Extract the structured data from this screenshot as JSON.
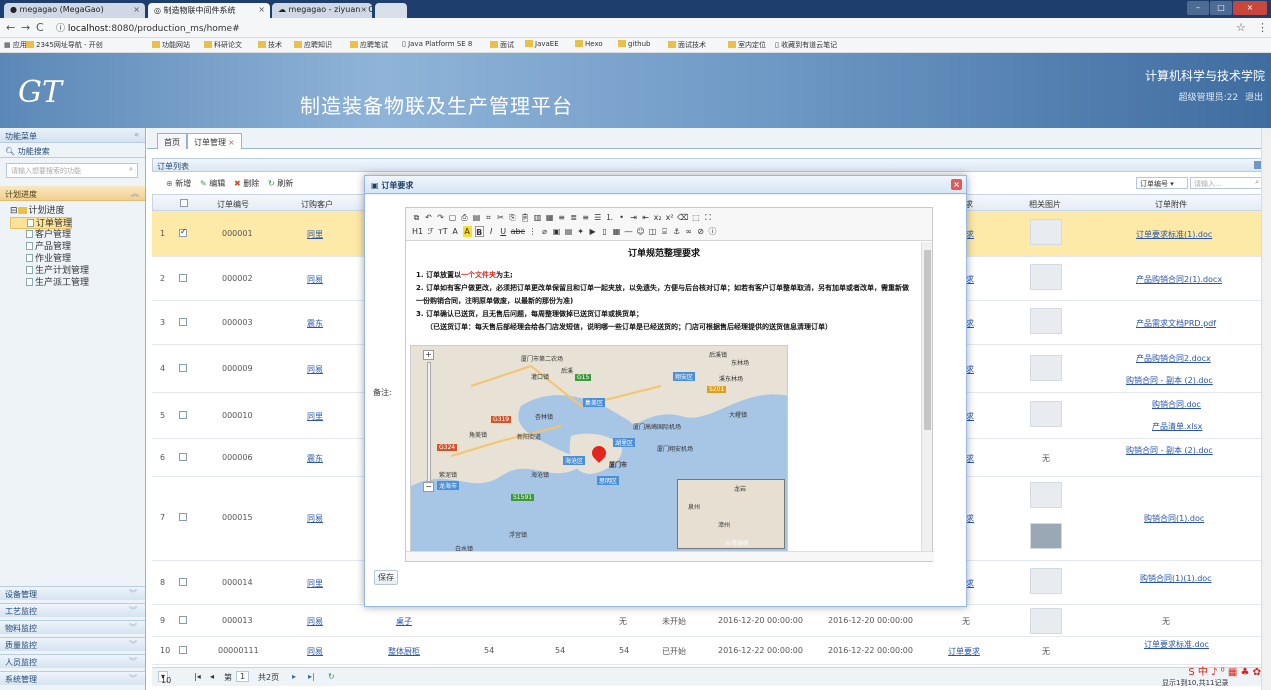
{
  "browser": {
    "tabs": [
      {
        "label": "megagao (MegaGao)"
      },
      {
        "label": "制造物联中间件系统"
      },
      {
        "label": "megagao - ziyuan - Co"
      }
    ],
    "url_host": "localhost",
    "url_path": ":8080/production_ms/home#",
    "bookmarks": [
      "应用",
      "2345网址导航 - 开创",
      "功能网站",
      "科研论文",
      "技术",
      "应聘知识",
      "应聘笔试",
      "Java Platform SE 8",
      "面试",
      "JavaEE",
      "Hexo",
      "github",
      "面试技术",
      "室内定位",
      "收藏到有道云笔记"
    ]
  },
  "header": {
    "logo": "GT",
    "title": "制造装备物联及生产管理平台",
    "school": "计算机科学与技术学院",
    "user": "超级管理员:22",
    "logout": "退出"
  },
  "sidebar": {
    "head": "功能菜单",
    "search_head": "功能搜索",
    "search_placeholder": "请输入想要搜索的功能",
    "section": "计划进度",
    "tree_root": "计划进度",
    "items": [
      "订单管理",
      "客户管理",
      "产品管理",
      "作业管理",
      "生产计划管理",
      "生产派工管理"
    ],
    "accordions": [
      "设备管理",
      "工艺监控",
      "物料监控",
      "质量监控",
      "人员监控",
      "系统管理"
    ]
  },
  "main": {
    "tabs": [
      "首页",
      "订单管理"
    ],
    "list_title": "订单列表",
    "toolbar": {
      "add": "新增",
      "edit": "编辑",
      "delete": "删除",
      "refresh": "刷新"
    },
    "filter_select": "订单编号",
    "filter_placeholder": "请输入...",
    "columns": {
      "no": "订单编号",
      "customer": "订购客户",
      "req": "求",
      "pic": "相关图片",
      "attach": "订单附件"
    },
    "rows": [
      {
        "idx": "1",
        "no": "000001",
        "cust": "同里",
        "req": "需求",
        "pic": "",
        "attach": "订单要求标准(1).doc",
        "attach2": ""
      },
      {
        "idx": "2",
        "no": "000002",
        "cust": "同易",
        "req": "需求",
        "pic": "",
        "attach": "产品购销合同2(1).docx",
        "attach2": ""
      },
      {
        "idx": "3",
        "no": "000003",
        "cust": "震东",
        "req": "需求",
        "pic": "",
        "attach": "产品需求文档PRD.pdf",
        "attach2": ""
      },
      {
        "idx": "4",
        "no": "000009",
        "cust": "同易",
        "req": "需求",
        "pic": "",
        "attach": "产品购销合同2.docx",
        "attach2": "购销合同 - 副本 (2).doc"
      },
      {
        "idx": "5",
        "no": "000010",
        "cust": "同里",
        "req": "需求",
        "pic": "",
        "attach": "购销合同.doc",
        "attach2": "产品清单.xlsx"
      },
      {
        "idx": "6",
        "no": "000006",
        "cust": "震东",
        "req": "需求",
        "pic": "无",
        "attach": "购销合同 - 副本 (2).doc",
        "attach2": ""
      },
      {
        "idx": "7",
        "no": "000015",
        "cust": "同易",
        "req": "需求",
        "pic": "",
        "attach": "购销合同(1).doc",
        "attach2": ""
      },
      {
        "idx": "8",
        "no": "000014",
        "cust": "同里",
        "req": "需求",
        "pic": "",
        "attach": "购销合同(1)(1).doc",
        "attach2": ""
      }
    ],
    "row9": {
      "idx": "9",
      "no": "000013",
      "cust": "同易",
      "product": "桌子",
      "c1": "无",
      "status": "未开始",
      "start": "2016-12-20 00:00:00",
      "end": "2016-12-20 00:00:00",
      "req": "无",
      "attach": "无"
    },
    "row10": {
      "idx": "10",
      "no": "00000111",
      "cust": "同易",
      "product": "整体厨柜",
      "q1": "54",
      "q2": "54",
      "q3": "54",
      "status": "已开始",
      "start": "2016-12-22 00:00:00",
      "end": "2016-12-22 00:00:00",
      "req": "订单要求",
      "pic": "无",
      "attach": "订单要求标准.doc"
    },
    "pager": {
      "size": "10",
      "page_label": "第",
      "page": "1",
      "total_pages": "共2页",
      "summary": "显示1到10,共11记录"
    }
  },
  "dialog": {
    "title": "订单要求",
    "remark_label": "备注:",
    "save": "保存",
    "doc_title": "订单规范整理要求",
    "p1_a": "1. 订单放置以",
    "p1_red": "一个文件夹",
    "p1_b": "为主;",
    "p2": "2. 订单如有客户做更改，必须把订单更改单保留且和订单一起夹放，以免遗失，方便与后台核对订单；如若有客户订单整单取消，另有加单或者改单，需重新做一份购销合同，注明原单做废，以最新的那份为准)",
    "p3": "3. 订单确认已送货，且无售后问题，每周整理做掉已送货订单或换货单；",
    "p4": "（已送货订单：每天售后部经理会给各门店发短信，说明哪一些订单是已经送货的；门店可根据售后经理提供的送货信息清理订单）",
    "map_labels": [
      "厦门市第二农场",
      "后溪镇",
      "东林场",
      "灌口镇",
      "后溪",
      "翔安区",
      "溪东林场",
      "集美区",
      "杏林镇",
      "厦门高崎国际机场",
      "大嶝镇",
      "角美镇",
      "新阳街道",
      "湖里区",
      "厦门翔安机场",
      "海沧区",
      "厦门市",
      "思明区",
      "紫泥镇",
      "海沧镇",
      "龙海市",
      "浮宫镇",
      "白水镇",
      "台湾海峡",
      "龙岩",
      "泉州",
      "漳州"
    ],
    "map_roads": [
      "G15",
      "G319",
      "S201",
      "G324",
      "S1591"
    ]
  },
  "colors": {
    "accent": "#3f6d9f",
    "selected_row": "#fde9a8",
    "link": "#2a56a8",
    "close": "#e15959"
  }
}
